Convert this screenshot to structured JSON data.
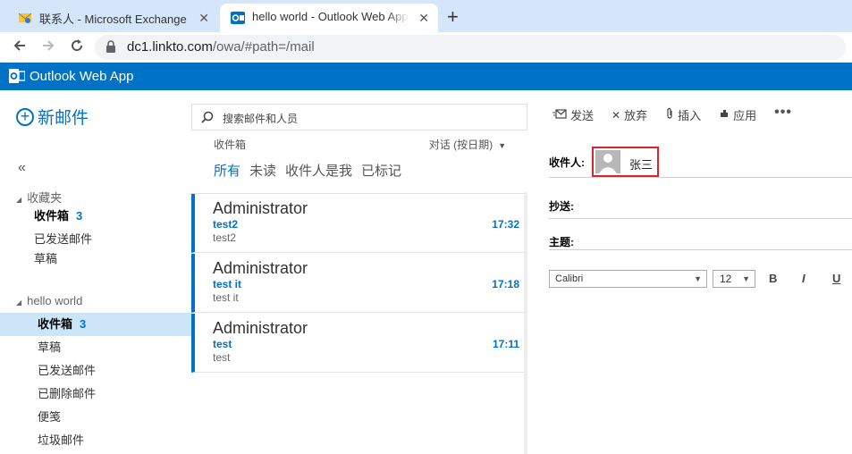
{
  "browser": {
    "tabs": [
      {
        "title": "联系人 - Microsoft Exchange",
        "close": "✕"
      },
      {
        "title": "hello world - Outlook Web App",
        "close": "✕"
      }
    ],
    "new_tab": "+",
    "url_host": "dc1.linkto.com",
    "url_path": "/owa/#path=/mail"
  },
  "header": {
    "app_title": "Outlook Web App"
  },
  "leftnav": {
    "new_mail": "新邮件",
    "favorites": {
      "title": "收藏夹",
      "items": [
        {
          "label": "收件箱",
          "count": "3"
        },
        {
          "label": "已发送邮件"
        },
        {
          "label": "草稿"
        }
      ]
    },
    "mailbox": {
      "title": "hello world",
      "items": [
        {
          "label": "收件箱",
          "count": "3"
        },
        {
          "label": "草稿"
        },
        {
          "label": "已发送邮件"
        },
        {
          "label": "已删除邮件"
        },
        {
          "label": "便笺"
        },
        {
          "label": "垃圾邮件"
        }
      ]
    }
  },
  "list": {
    "search_placeholder": "搜索邮件和人员",
    "folder_name": "收件箱",
    "sort_label": "对话 (按日期)",
    "filters": [
      "所有",
      "未读",
      "收件人是我",
      "已标记"
    ],
    "messages": [
      {
        "sender": "Administrator",
        "subject": "test2",
        "preview": "test2",
        "time": "17:32"
      },
      {
        "sender": "Administrator",
        "subject": "test it",
        "preview": "test it",
        "time": "17:18"
      },
      {
        "sender": "Administrator",
        "subject": "test",
        "preview": "test",
        "time": "17:11"
      }
    ]
  },
  "compose": {
    "toolbar": {
      "send": "发送",
      "discard": "放弃",
      "insert": "插入",
      "apply": "应用",
      "more": "•••"
    },
    "to_label": "收件人:",
    "recipient": "张三",
    "cc_label": "抄送:",
    "subject_label": "主题:",
    "font": "Calibri",
    "size": "12",
    "bold": "B",
    "italic": "I",
    "underline": "U"
  },
  "colors": {
    "brand": "#0072c6",
    "selected_bg": "#cde6f7",
    "highlight_border": "#d9262c"
  }
}
